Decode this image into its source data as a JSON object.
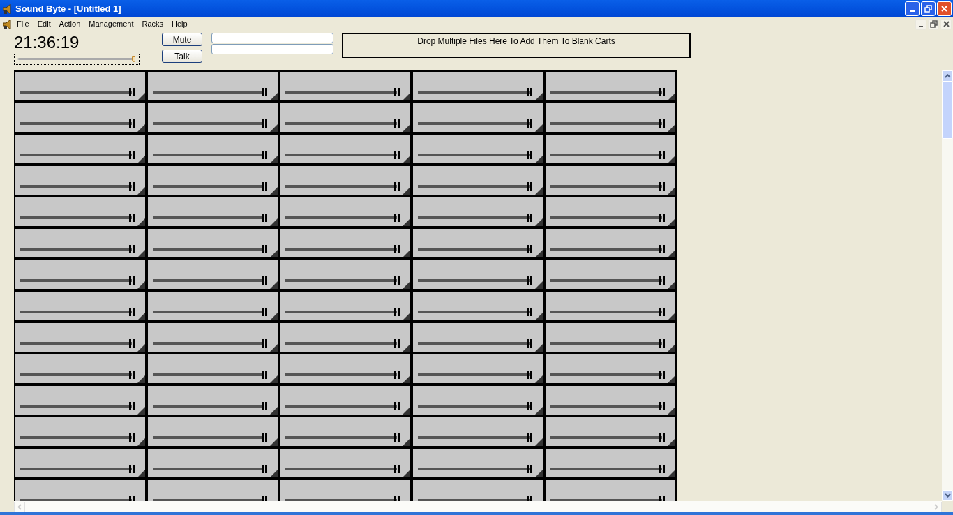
{
  "window": {
    "title": "Sound Byte - [Untitled 1]"
  },
  "menu": [
    "File",
    "Edit",
    "Action",
    "Management",
    "Racks",
    "Help"
  ],
  "clock": {
    "time": "21:36:19",
    "level": 1
  },
  "buttons": [
    "Mute",
    "Talk"
  ],
  "drop_zone": {
    "text": "Drop Multiple Files Here To Add Them To Blank Carts"
  },
  "cart_rows": [
    {
      "carts": [
        {
          "level": 1
        },
        {
          "level": 1
        },
        {
          "level": 1
        },
        {
          "level": 1
        },
        {
          "level": 1
        }
      ]
    },
    {
      "carts": [
        {
          "level": 1
        },
        {
          "level": 1
        },
        {
          "level": 1
        },
        {
          "level": 1
        },
        {
          "level": 1
        }
      ]
    },
    {
      "carts": [
        {
          "level": 1
        },
        {
          "level": 1
        },
        {
          "level": 1
        },
        {
          "level": 1
        },
        {
          "level": 1
        }
      ]
    },
    {
      "carts": [
        {
          "level": 1
        },
        {
          "level": 1
        },
        {
          "level": 1
        },
        {
          "level": 1
        },
        {
          "level": 1
        }
      ]
    },
    {
      "carts": [
        {
          "level": 1
        },
        {
          "level": 1
        },
        {
          "level": 1
        },
        {
          "level": 1
        },
        {
          "level": 1
        }
      ]
    },
    {
      "carts": [
        {
          "level": 1
        },
        {
          "level": 1
        },
        {
          "level": 1
        },
        {
          "level": 1
        },
        {
          "level": 1
        }
      ]
    },
    {
      "carts": [
        {
          "level": 1
        },
        {
          "level": 1
        },
        {
          "level": 1
        },
        {
          "level": 1
        },
        {
          "level": 1
        }
      ]
    },
    {
      "carts": [
        {
          "level": 1
        },
        {
          "level": 1
        },
        {
          "level": 1
        },
        {
          "level": 1
        },
        {
          "level": 1
        }
      ]
    },
    {
      "carts": [
        {
          "level": 1
        },
        {
          "level": 1
        },
        {
          "level": 1
        },
        {
          "level": 1
        },
        {
          "level": 1
        }
      ]
    },
    {
      "carts": [
        {
          "level": 1
        },
        {
          "level": 1
        },
        {
          "level": 1
        },
        {
          "level": 1
        },
        {
          "level": 1
        }
      ]
    },
    {
      "carts": [
        {
          "level": 1
        },
        {
          "level": 1
        },
        {
          "level": 1
        },
        {
          "level": 1
        },
        {
          "level": 1
        }
      ]
    },
    {
      "carts": [
        {
          "level": 1
        },
        {
          "level": 1
        },
        {
          "level": 1
        },
        {
          "level": 1
        },
        {
          "level": 1
        }
      ]
    },
    {
      "carts": [
        {
          "level": 1
        },
        {
          "level": 1
        },
        {
          "level": 1
        },
        {
          "level": 1
        },
        {
          "level": 1
        }
      ]
    },
    {
      "carts": [
        {
          "level": 1
        },
        {
          "level": 1
        },
        {
          "level": 1
        },
        {
          "level": 1
        },
        {
          "level": 1
        }
      ]
    }
  ]
}
